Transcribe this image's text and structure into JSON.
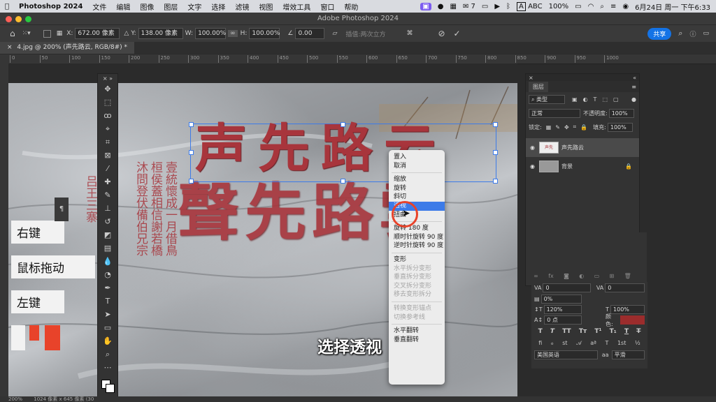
{
  "menubar": {
    "app": "Photoshop 2024",
    "items": [
      "文件",
      "编辑",
      "图像",
      "图层",
      "文字",
      "选择",
      "滤镜",
      "视图",
      "增效工具",
      "窗口",
      "帮助"
    ],
    "wechat_count": "7",
    "input_method": "ABC",
    "battery": "100%",
    "datetime": "6月24日 周一 下午6:33"
  },
  "window": {
    "title": "Adobe Photoshop 2024"
  },
  "options": {
    "x_label": "X:",
    "x_value": "672.00 像素",
    "y_label": "Y:",
    "y_value": "138.00 像素",
    "w_label": "W:",
    "w_value": "100.00%",
    "h_label": "H:",
    "h_value": "100.00%",
    "angle_value": "0.00",
    "interp_label": "插值:",
    "interp_value": "两次立方",
    "share_label": "共享"
  },
  "document": {
    "tab_label": "4.jpg @ 200% (声先路云, RGB/8#) *"
  },
  "ruler": {
    "ticks": [
      "0",
      "50",
      "100",
      "150",
      "200",
      "250",
      "300",
      "350",
      "400",
      "450",
      "500",
      "550",
      "600",
      "650",
      "700",
      "750",
      "800",
      "850",
      "900",
      "950",
      "1000"
    ]
  },
  "canvas": {
    "line1": "声先路云",
    "line2": "聲先路雲",
    "side_text": "壹統懷成一月借鳥 桓侯蓋相信謝若橋 沐問登伏備伯兄宗",
    "left_text": "吕王三寨"
  },
  "labels": {
    "right_click": "右键",
    "mouse_drag": "鼠标拖动",
    "left_click": "左键"
  },
  "context_menu": {
    "items": [
      {
        "label": "置入",
        "state": "normal"
      },
      {
        "label": "取消",
        "state": "normal"
      },
      {
        "sep": true
      },
      {
        "label": "缩放",
        "state": "normal"
      },
      {
        "label": "旋转",
        "state": "normal"
      },
      {
        "label": "斜切",
        "state": "normal"
      },
      {
        "label": "透视",
        "state": "highlight"
      },
      {
        "label": "扭曲",
        "state": "normal"
      },
      {
        "sep": true
      },
      {
        "label": "旋转 180 度",
        "state": "normal"
      },
      {
        "label": "顺时针旋转 90 度",
        "state": "normal"
      },
      {
        "label": "逆时针旋转 90 度",
        "state": "normal"
      },
      {
        "sep": true
      },
      {
        "label": "变形",
        "state": "normal"
      },
      {
        "label": "水平拆分变形",
        "state": "disabled"
      },
      {
        "label": "垂直拆分变形",
        "state": "disabled"
      },
      {
        "label": "交叉拆分变形",
        "state": "disabled"
      },
      {
        "label": "移去变形拆分",
        "state": "disabled"
      },
      {
        "sep": true
      },
      {
        "label": "转换变形锚点",
        "state": "disabled"
      },
      {
        "label": "切换参考线",
        "state": "disabled"
      },
      {
        "sep": true
      },
      {
        "label": "水平翻转",
        "state": "normal"
      },
      {
        "label": "垂直翻转",
        "state": "normal"
      }
    ]
  },
  "caption": "选择透视",
  "layers": {
    "tab": "图层",
    "filter": "类型",
    "blend_mode": "正常",
    "opacity_label": "不透明度:",
    "opacity_value": "100%",
    "lock_label": "锁定:",
    "fill_label": "填充:",
    "fill_value": "100%",
    "list": [
      {
        "name": "声先路云"
      },
      {
        "name": "背景"
      }
    ]
  },
  "character": {
    "tracking": "0",
    "kerning": "0",
    "vscale_pct": "0%",
    "leading": "120%",
    "hscale": "100%",
    "baseline": "0 点",
    "color_label": "颜色:",
    "text_color": "#9b2c2c",
    "language": "美国英语",
    "aa_icon": "aa",
    "antialias": "平滑"
  },
  "status": {
    "zoom": "200%",
    "size": "1024 像素 x 645 像素 (30"
  },
  "colors": {
    "accent": "#3d7be8",
    "inscription": "#a8353c"
  }
}
